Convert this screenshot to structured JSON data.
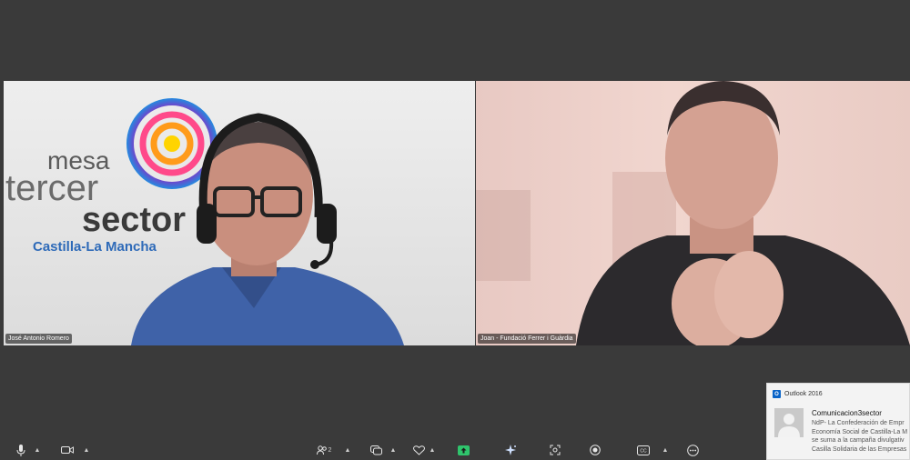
{
  "participants": [
    {
      "name": "José Antonio Romero"
    },
    {
      "name": "Joan - Fundació Ferrer i Guàrdia"
    }
  ],
  "background_logo": {
    "line1": "mesa",
    "line2": "tercer",
    "line3": "sector",
    "region": "Castilla-La Mancha"
  },
  "toolbar": {
    "participants_count": "2",
    "icons": {
      "mic": "microphone-icon",
      "camera": "camera-icon",
      "participants": "participants-icon",
      "chat": "chat-icon",
      "react": "heart-icon",
      "share": "share-screen-icon",
      "ai": "sparkle-icon",
      "apps": "apps-icon",
      "record": "record-icon",
      "captions": "captions-icon",
      "more": "more-icon"
    },
    "share_color": "#2fc46c"
  },
  "notification": {
    "app": "Outlook 2016",
    "sender": "Comunicacion3sector",
    "lines": [
      "NdP- La Confederación de Empr",
      "Economía Social de Castilla-La M",
      "se suma a la campaña divulgativ",
      "Casilla Solidaria de las Empresas"
    ]
  }
}
